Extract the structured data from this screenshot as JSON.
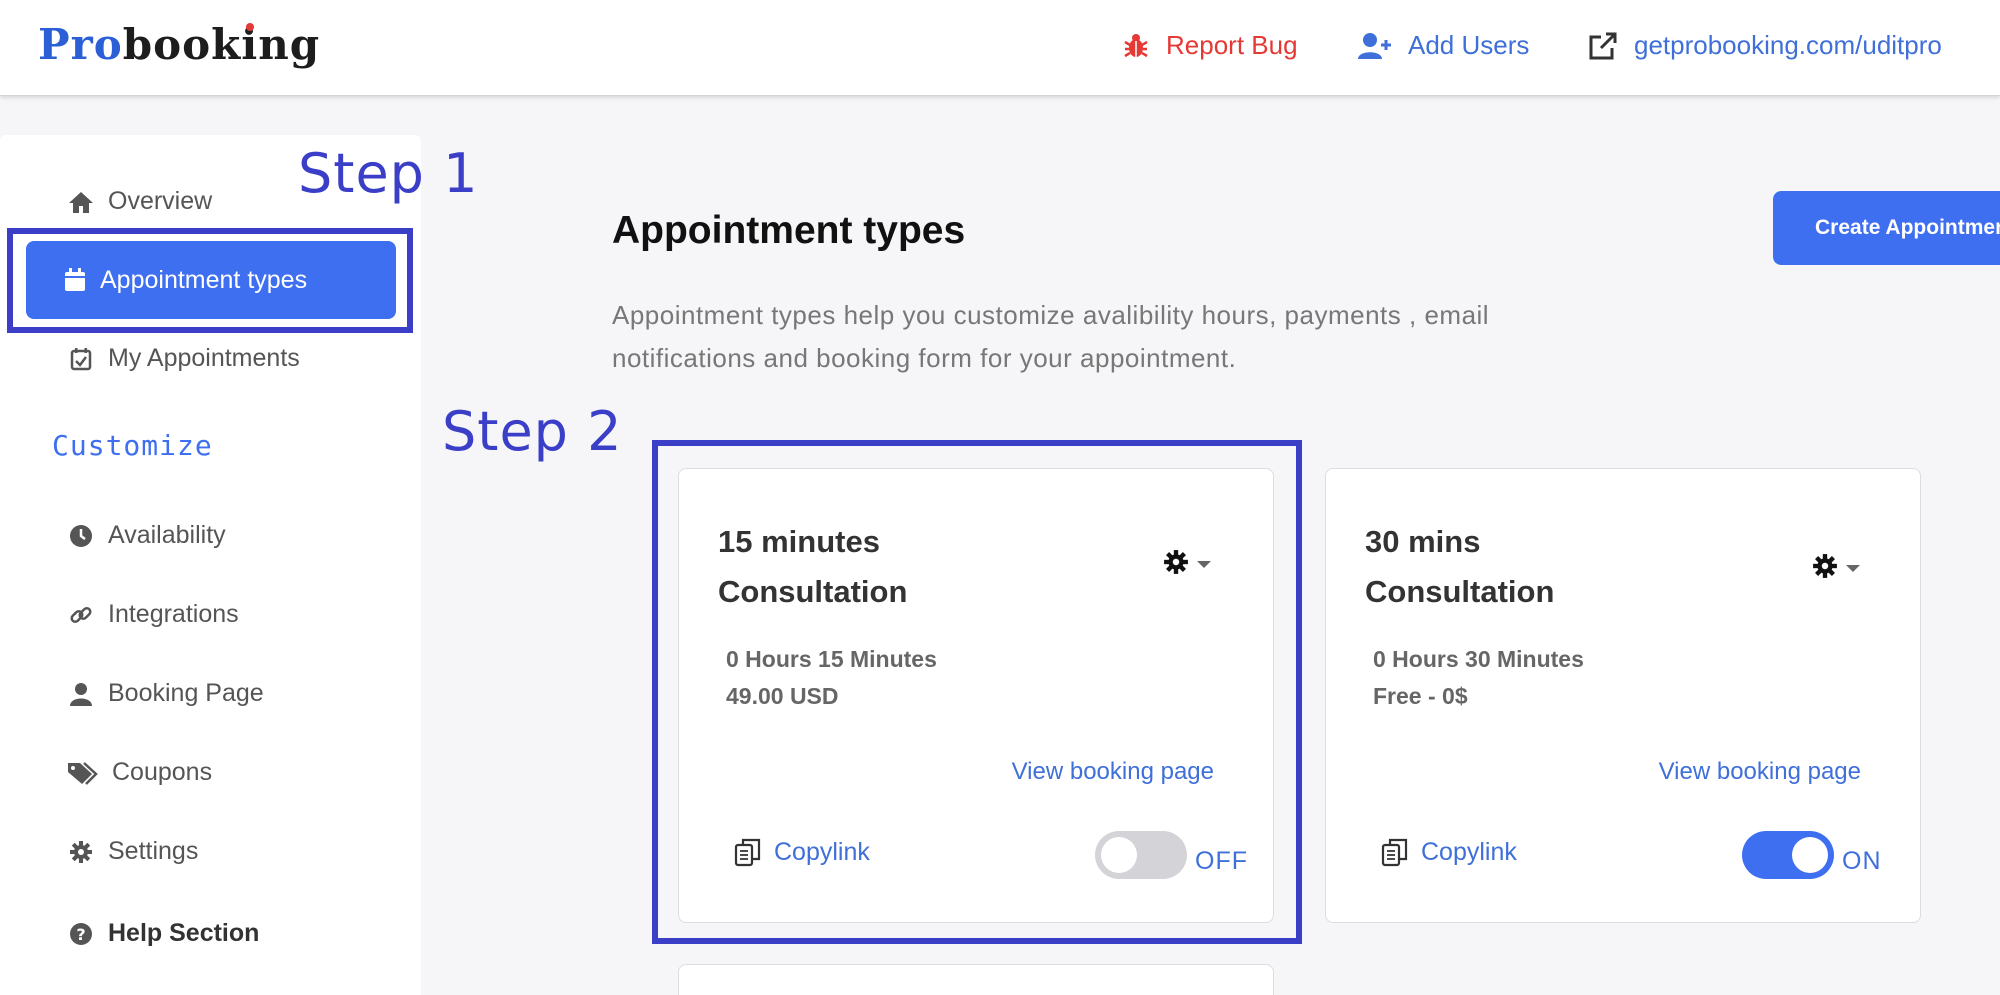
{
  "brand": {
    "pro": "Pro",
    "booking_pre": "book",
    "booking_i": "i",
    "booking_post": "ng"
  },
  "header": {
    "report_bug": "Report Bug",
    "add_users": "Add Users",
    "booking_url": "getprobooking.com/uditpro"
  },
  "sidebar": {
    "overview": "Overview",
    "appointment_types": "Appointment types",
    "my_appointments": "My Appointments",
    "customize": "Customize",
    "availability": "Availability",
    "integrations": "Integrations",
    "booking_page": "Booking Page",
    "coupons": "Coupons",
    "settings": "Settings",
    "help": "Help Section"
  },
  "annotations": {
    "step1": "Step 1",
    "step2": "Step 2"
  },
  "main": {
    "title": "Appointment types",
    "description": "Appointment types help you customize avalibility hours, payments , email notifications and booking form for your appointment.",
    "create_button": "Create Appointment"
  },
  "cards": [
    {
      "title_line1": "15 minutes",
      "title_line2": "Consultation",
      "duration": "0 Hours 15 Minutes",
      "price": "49.00 USD",
      "view_link": "View booking page",
      "copylink": "Copylink",
      "toggle_label": "OFF",
      "enabled": false
    },
    {
      "title_line1": "30 mins",
      "title_line2": "Consultation",
      "duration": "0 Hours 30 Minutes",
      "price": "Free - 0$",
      "view_link": "View booking page",
      "copylink": "Copylink",
      "toggle_label": "ON",
      "enabled": true
    }
  ],
  "colors": {
    "accent": "#3f6ff1",
    "annotation": "#3b3fc7",
    "danger": "#e53935",
    "link": "#3f6fd9"
  }
}
